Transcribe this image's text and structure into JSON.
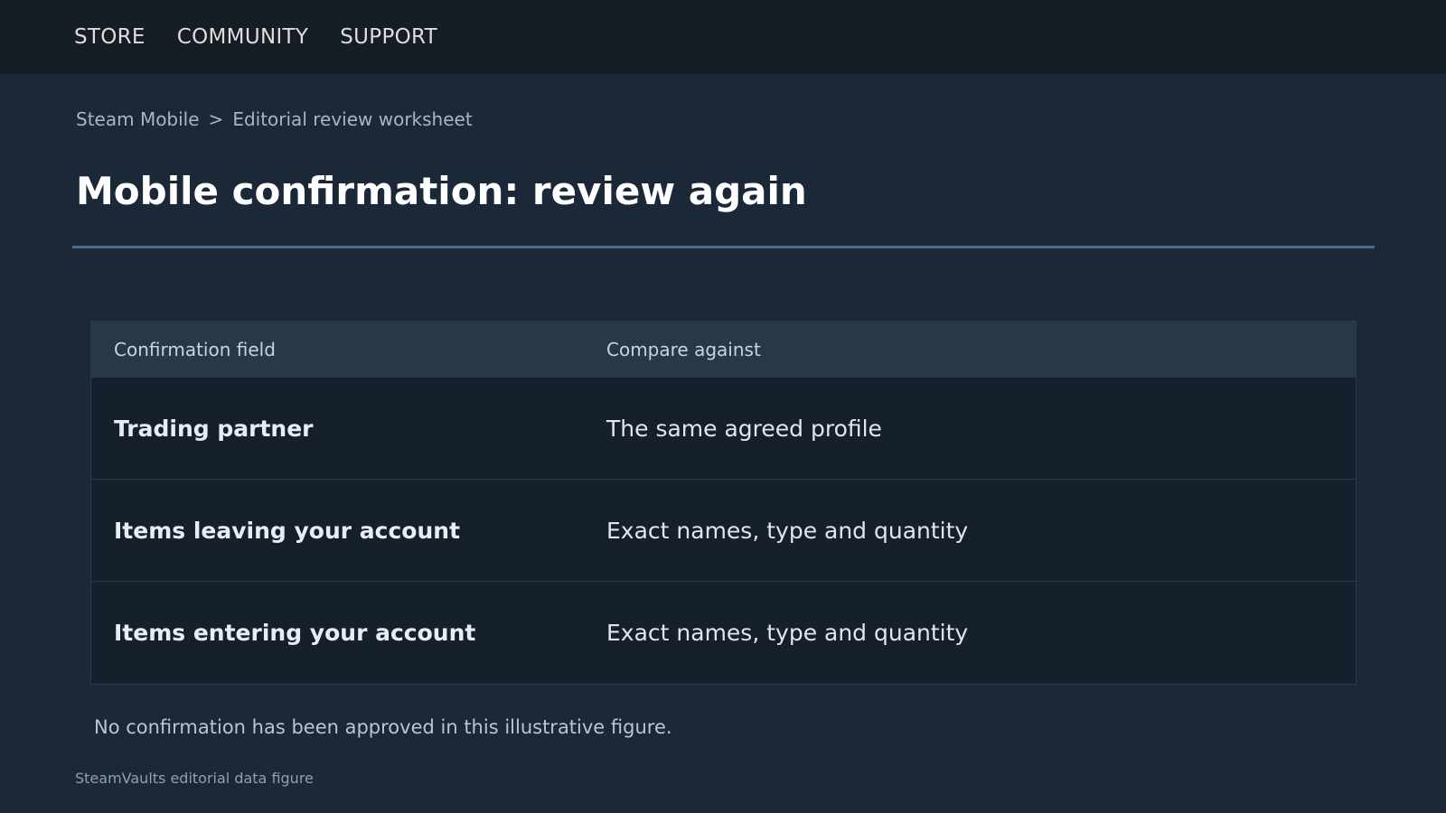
{
  "nav": {
    "items": [
      {
        "label": "STORE"
      },
      {
        "label": "COMMUNITY"
      },
      {
        "label": "SUPPORT"
      }
    ]
  },
  "breadcrumb": {
    "parent": "Steam Mobile",
    "separator": ">",
    "current": "Editorial review worksheet"
  },
  "page": {
    "title": "Mobile confirmation: review again"
  },
  "table": {
    "headers": [
      "Confirmation field",
      "Compare against"
    ],
    "rows": [
      {
        "field": "Trading partner",
        "compare": "The same agreed profile"
      },
      {
        "field": "Items leaving your account",
        "compare": "Exact names, type and quantity"
      },
      {
        "field": "Items entering your account",
        "compare": "Exact names, type and quantity"
      }
    ]
  },
  "note": "No confirmation has been approved in this illustrative figure.",
  "footer": {
    "caption": "SteamVaults editorial data figure"
  },
  "colors": {
    "background": "#1b2838",
    "nav_background": "#171d25",
    "accent_rule": "#4c6b8e",
    "table_header": "#283847",
    "table_row": "#16202d"
  }
}
